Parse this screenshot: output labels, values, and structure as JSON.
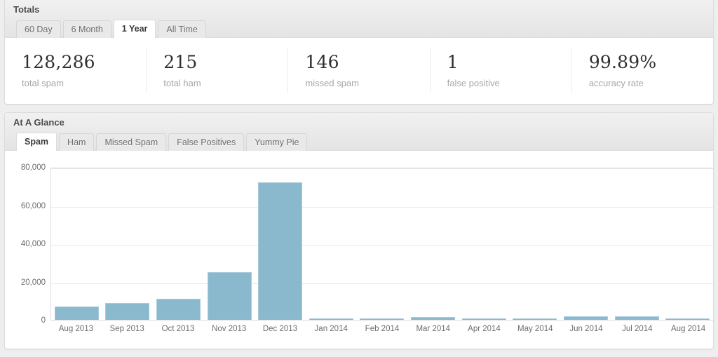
{
  "totals": {
    "title": "Totals",
    "tabs": [
      {
        "label": "60 Day",
        "active": false
      },
      {
        "label": "6 Month",
        "active": false
      },
      {
        "label": "1 Year",
        "active": true
      },
      {
        "label": "All Time",
        "active": false
      }
    ],
    "stats": [
      {
        "value": "128,286",
        "label": "total spam"
      },
      {
        "value": "215",
        "label": "total ham"
      },
      {
        "value": "146",
        "label": "missed spam"
      },
      {
        "value": "1",
        "label": "false positive"
      },
      {
        "value": "99.89%",
        "label": "accuracy rate"
      }
    ]
  },
  "glance": {
    "title": "At A Glance",
    "tabs": [
      {
        "label": "Spam",
        "active": true
      },
      {
        "label": "Ham",
        "active": false
      },
      {
        "label": "Missed Spam",
        "active": false
      },
      {
        "label": "False Positives",
        "active": false
      },
      {
        "label": "Yummy Pie",
        "active": false
      }
    ]
  },
  "chart_data": {
    "type": "bar",
    "title": "",
    "xlabel": "",
    "ylabel": "",
    "categories": [
      "Aug 2013",
      "Sep 2013",
      "Oct 2013",
      "Nov 2013",
      "Dec 2013",
      "Jan 2014",
      "Feb 2014",
      "Mar 2014",
      "Apr 2014",
      "May 2014",
      "Jun 2014",
      "Jul 2014",
      "Aug 2014"
    ],
    "values": [
      7000,
      8700,
      11000,
      25000,
      71800,
      500,
      500,
      1400,
      700,
      700,
      1800,
      1800,
      600
    ],
    "ylim": [
      0,
      80000
    ],
    "yticks": [
      0,
      20000,
      40000,
      60000,
      80000
    ],
    "ytick_labels": [
      "0",
      "20,000",
      "40,000",
      "60,000",
      "80,000"
    ],
    "grid": true,
    "legend": false,
    "bar_color": "#8ab9ce",
    "bar_border_color": "#a8cbdb"
  }
}
